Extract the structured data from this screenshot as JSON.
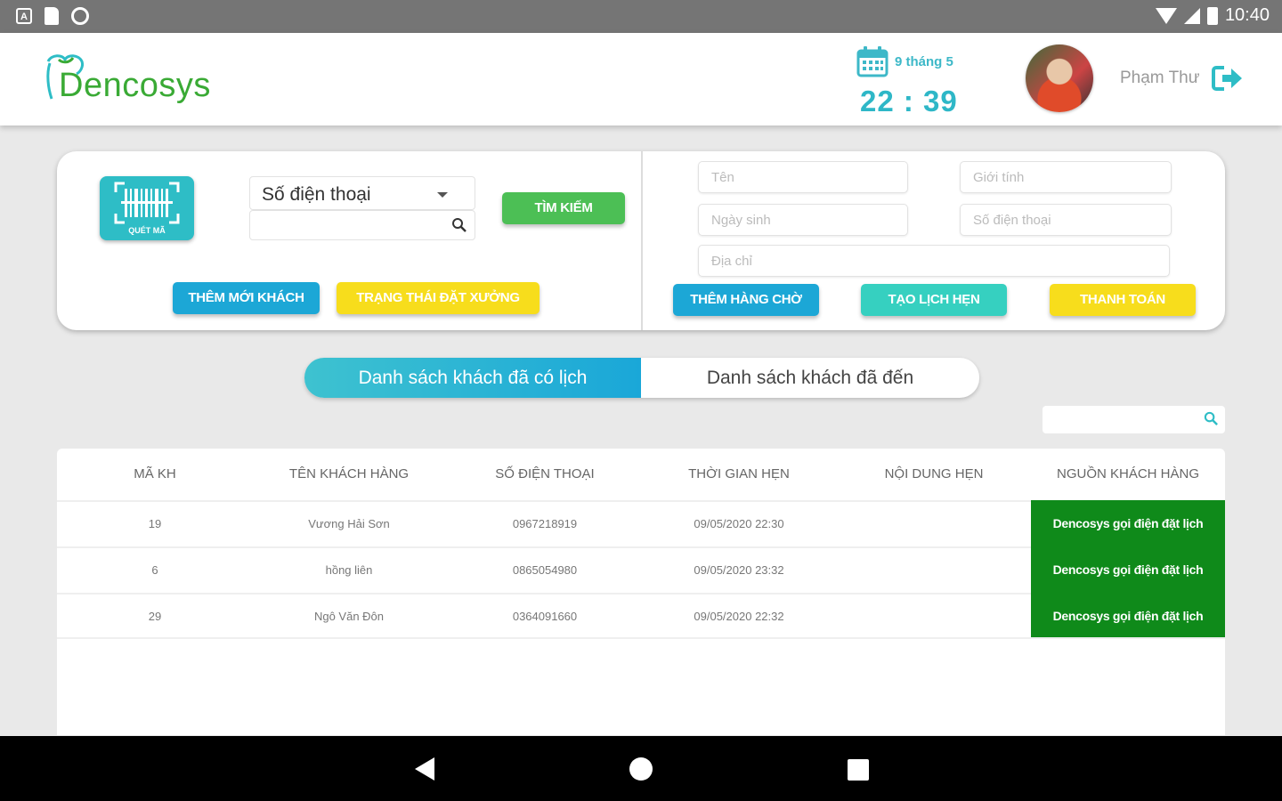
{
  "status_bar": {
    "time": "10:40",
    "left_icons": [
      "a-icon",
      "sd-card-icon",
      "circle-icon"
    ],
    "a_glyph": "A"
  },
  "header": {
    "logo": "Dencosys",
    "date": "9 tháng 5",
    "time": "22 : 39",
    "user_name": "Phạm Thư",
    "icons": [
      "calendar-icon",
      "logout-icon"
    ]
  },
  "search_panel": {
    "scan_label": "QUÉT MÃ",
    "select_value": "Số điện thoại",
    "search_value": "",
    "search_button": "TÌM KIẾM",
    "add_customer_button": "THÊM MỚI KHÁCH",
    "status_button": "TRẠNG THÁI ĐẶT XƯỞNG"
  },
  "customer_form": {
    "name_placeholder": "Tên",
    "gender_placeholder": "Giới tính",
    "dob_placeholder": "Ngày sinh",
    "phone_placeholder": "Số điện thoại",
    "address_placeholder": "Địa chỉ",
    "add_queue_button": "THÊM HÀNG CHỜ",
    "create_appointment_button": "TẠO LỊCH HẸN",
    "payment_button": "THANH TOÁN"
  },
  "tabs": {
    "scheduled": "Danh sách khách đã có lịch",
    "arrived": "Danh sách khách đã đến"
  },
  "table": {
    "search_value": "",
    "headers": [
      "MÃ KH",
      "TÊN KHÁCH HÀNG",
      "SỐ ĐIỆN THOẠI",
      "THỜI GIAN HẸN",
      "NỘI DUNG HẸN",
      "NGUỒN KHÁCH HÀNG"
    ],
    "rows": [
      {
        "id": "19",
        "name": "Vương Hải Sơn",
        "phone": "0967218919",
        "time": "09/05/2020 22:30",
        "content": "",
        "source": "Dencosys gọi điện đặt lịch"
      },
      {
        "id": "6",
        "name": "hồng liên",
        "phone": "0865054980",
        "time": "09/05/2020 23:32",
        "content": "",
        "source": "Dencosys gọi điện đặt lịch"
      },
      {
        "id": "29",
        "name": "Ngô Văn Đôn",
        "phone": "0364091660",
        "time": "09/05/2020 22:32",
        "content": "",
        "source": "Dencosys gọi điện đặt lịch"
      }
    ]
  },
  "colors": {
    "brand_teal": "#2ebdc6",
    "brand_green": "#3aaa35",
    "button_blue": "#1ca7d6",
    "button_yellow": "#f7dd1c",
    "button_teal": "#36d0c0",
    "source_green": "#0f8a1a"
  }
}
